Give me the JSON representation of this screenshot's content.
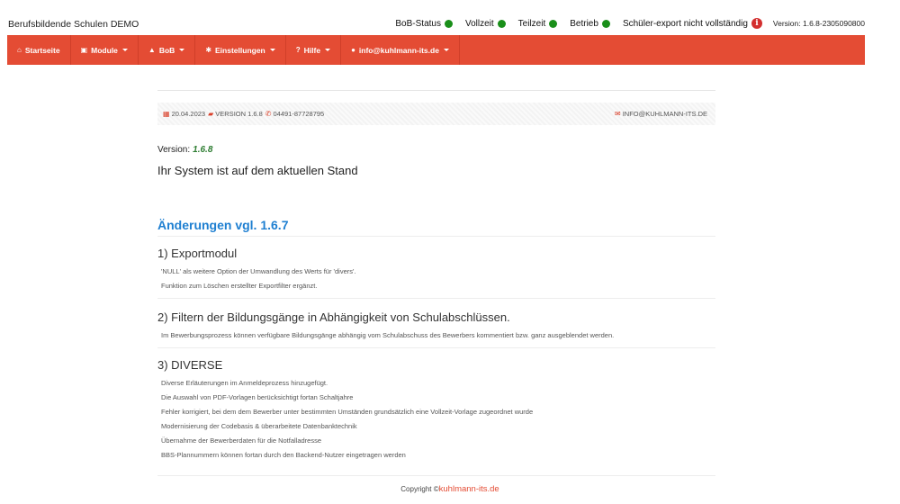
{
  "header": {
    "brand": "Berufsbildende Schulen DEMO",
    "statuses": [
      {
        "label": "BoB-Status",
        "state": "ok"
      },
      {
        "label": "Vollzeit",
        "state": "ok"
      },
      {
        "label": "Teilzeit",
        "state": "ok"
      },
      {
        "label": "Betrieb",
        "state": "ok"
      },
      {
        "label": "Schüler-export nicht vollständig",
        "state": "warning"
      }
    ],
    "version": "Version: 1.6.8-2305090800",
    "colors": {
      "ok": "#1a8f1a",
      "warning": "#d32f2f",
      "accent": "#e44c34"
    }
  },
  "nav": {
    "items": [
      {
        "label": "Startseite",
        "icon": "home-icon",
        "dropdown": false
      },
      {
        "label": "Module",
        "icon": "print-icon",
        "dropdown": true
      },
      {
        "label": "BoB",
        "icon": "graduation-cap-icon",
        "dropdown": true
      },
      {
        "label": "Einstellungen",
        "icon": "gear-icon",
        "dropdown": true
      },
      {
        "label": "Hilfe",
        "icon": "question-icon",
        "dropdown": true
      },
      {
        "label": "info@kuhlmann-its.de",
        "icon": "user-icon",
        "dropdown": true
      }
    ]
  },
  "infobar": {
    "date": "20.04.2023",
    "version": "VERSION 1.6.8",
    "phone": "04491-87728795",
    "email": "INFO@KUHLMANN-ITS.DE"
  },
  "main": {
    "version_label": "Version:",
    "version_value": "1.6.8",
    "status_message": "Ihr System ist auf dem aktuellen Stand",
    "changes_title": "Änderungen vgl. 1.6.7",
    "sections": [
      {
        "title": "1) Exportmodul",
        "lines": [
          "'NULL' als weitere Option der Umwandlung des Werts für 'divers'.",
          "Funktion zum Löschen erstellter Exportfilter ergänzt."
        ]
      },
      {
        "title": "2) Filtern der Bildungsgänge in Abhängigkeit von Schulabschlüssen.",
        "lines": [
          " Im Bewerbungsprozess können verfügbare Bildungsgänge abhängig vom Schulabschuss des Bewerbers kommentiert bzw. ganz ausgeblendet werden."
        ]
      },
      {
        "title": "3) DIVERSE",
        "lines": [
          "Diverse Erläuterungen im Anmeldeprozess hinzugefügt.",
          "Die Auswahl von PDF-Vorlagen berücksichtigt fortan Schaltjahre",
          "Fehler korrigiert, bei dem dem Bewerber unter bestimmten Umständen grundsätzlich eine Vollzeit-Vorlage zugeordnet wurde",
          "Modernisierung der Codebasis & überarbeitete Datenbanktechnik",
          "Übernahme der Bewerberdaten für die Notfalladresse",
          "BBS-Plannummern können fortan durch den Backend-Nutzer eingetragen werden"
        ]
      }
    ]
  },
  "footer": {
    "copyright": "Copyright ©",
    "link": "kuhlmann-its.de"
  }
}
